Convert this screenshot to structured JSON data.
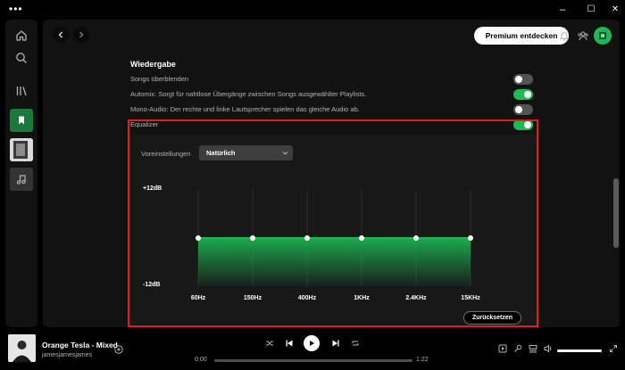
{
  "window": {
    "menu_glyph": "•••",
    "minimize": "–",
    "maximize": "☐",
    "close": "✕"
  },
  "header": {
    "premium_label": "Premium entdecken"
  },
  "settings": {
    "section_title": "Wiedergabe",
    "rows": [
      {
        "label": "Songs überblenden",
        "on": false
      },
      {
        "label": "Automix: Sorgt für nahtlose Übergänge zwischen Songs ausgewählter Playlists.",
        "on": true
      },
      {
        "label": "Mono-Audio: Der rechte und linke Lautsprecher spielen das gleiche Audio ab.",
        "on": false
      },
      {
        "label": "Equalizer",
        "on": true
      }
    ]
  },
  "equalizer": {
    "preset_label": "Voreinstellungen",
    "preset_value": "Natürlich",
    "db_max_label": "+12dB",
    "db_min_label": "-12dB",
    "db_range": [
      -12,
      12
    ],
    "bands": [
      {
        "freq": "60Hz",
        "gain": 0
      },
      {
        "freq": "150Hz",
        "gain": 0
      },
      {
        "freq": "400Hz",
        "gain": 0
      },
      {
        "freq": "1KHz",
        "gain": 0
      },
      {
        "freq": "2.4KHz",
        "gain": 0
      },
      {
        "freq": "15KHz",
        "gain": 0
      }
    ],
    "reset_label": "Zurücksetzen"
  },
  "player": {
    "track_title": "Orange Tesla - Mixed",
    "artist": "jamesjamesjames",
    "time_elapsed": "0:00",
    "time_total": "1:22",
    "progress": 0,
    "volume": 1.0
  },
  "colors": {
    "accent": "#1db954",
    "highlight": "#e01e1e"
  }
}
